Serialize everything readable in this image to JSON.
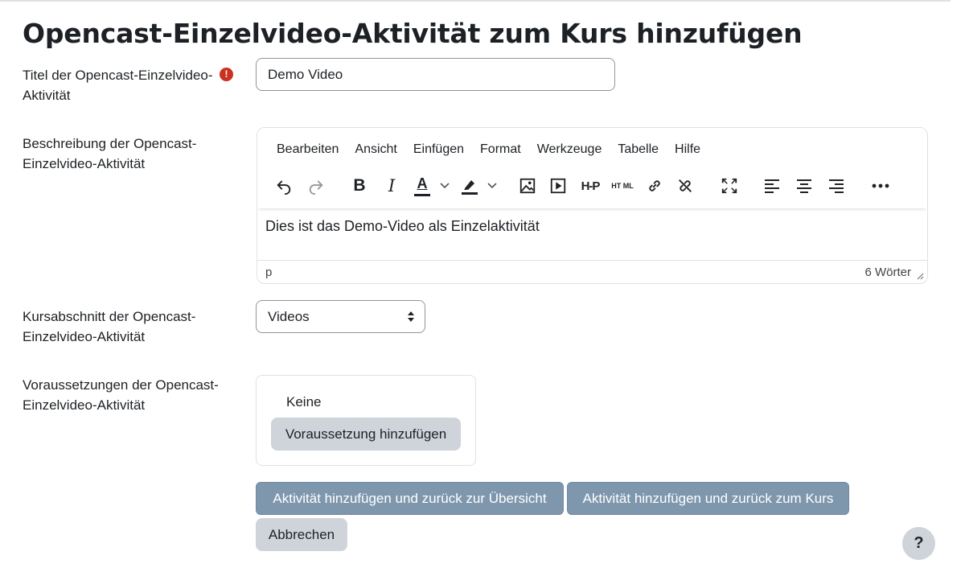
{
  "page": {
    "title": "Opencast-Einzelvideo-Aktivität zum Kurs hinzufügen"
  },
  "form": {
    "title_field": {
      "label": "Titel der Opencast-Einzelvideo-Aktivität",
      "required_icon": "exclamation-icon",
      "value": "Demo Video"
    },
    "description_field": {
      "label": "Beschreibung der Opencast-Einzelvideo-Aktivität",
      "menu": [
        "Bearbeiten",
        "Ansicht",
        "Einfügen",
        "Format",
        "Werkzeuge",
        "Tabelle",
        "Hilfe"
      ],
      "toolbar": {
        "undo": "undo-icon",
        "redo": "redo-icon",
        "bold": "B",
        "italic": "I",
        "text_color": "A",
        "highlight": "highlight-icon",
        "image": "image-icon",
        "media": "media-icon",
        "h5p": "H-P",
        "html": "HT ML",
        "link": "link-icon",
        "unlink": "unlink-icon",
        "fullscreen": "fullscreen-icon",
        "align_left": "align-left-icon",
        "align_center": "align-center-icon",
        "align_right": "align-right-icon",
        "more": "more-icon"
      },
      "content": "Dies ist das Demo-Video als Einzelaktivität",
      "status_path": "p",
      "word_count": "6 Wörter"
    },
    "section_field": {
      "label": "Kursabschnitt der Opencast-Einzelvideo-Aktivität",
      "selected": "Videos"
    },
    "restrictions_field": {
      "label": "Voraussetzungen der Opencast-Einzelvideo-Aktivität",
      "none_text": "Keine",
      "add_button": "Voraussetzung hinzufügen"
    }
  },
  "actions": {
    "save_return_overview": "Aktivität hinzufügen und zurück zur Übersicht",
    "save_return_course": "Aktivität hinzufügen und zurück zum Kurs",
    "cancel": "Abbrechen"
  },
  "help": {
    "label": "?"
  },
  "colors": {
    "primary_button": "#7f97ad",
    "secondary_button": "#ced4da",
    "required_icon": "#ca3120",
    "text": "#1d2125"
  }
}
